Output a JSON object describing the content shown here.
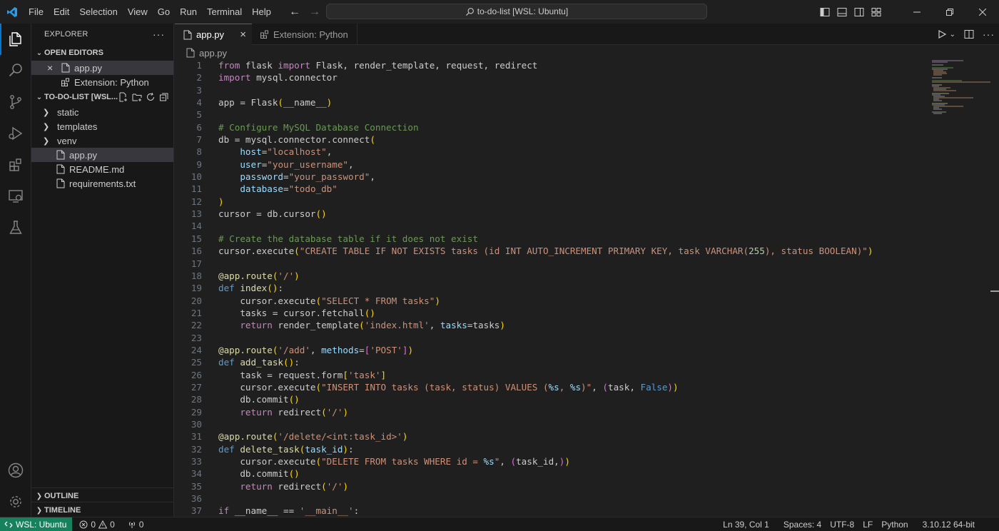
{
  "menu": [
    "File",
    "Edit",
    "Selection",
    "View",
    "Go",
    "Run",
    "Terminal",
    "Help"
  ],
  "command_center": {
    "text": "to-do-list [WSL: Ubuntu]"
  },
  "sidebar": {
    "title": "EXPLORER",
    "open_editors": {
      "label": "OPEN EDITORS",
      "items": [
        {
          "label": "app.py",
          "icon": "python-file-icon"
        },
        {
          "label": "Extension: Python",
          "icon": "extension-icon"
        }
      ]
    },
    "folder": {
      "label": "TO-DO-LIST [WSL...",
      "items": [
        {
          "label": "static",
          "type": "folder"
        },
        {
          "label": "templates",
          "type": "folder"
        },
        {
          "label": "venv",
          "type": "folder"
        },
        {
          "label": "app.py",
          "type": "file"
        },
        {
          "label": "README.md",
          "type": "file"
        },
        {
          "label": "requirements.txt",
          "type": "file"
        }
      ]
    },
    "outline_label": "OUTLINE",
    "timeline_label": "TIMELINE"
  },
  "tabs": [
    {
      "label": "app.py",
      "active": true
    },
    {
      "label": "Extension: Python",
      "active": false
    }
  ],
  "breadcrumb": {
    "file": "app.py"
  },
  "editor": {
    "line_numbers": [
      "1",
      "2",
      "3",
      "4",
      "5",
      "6",
      "7",
      "8",
      "9",
      "10",
      "11",
      "12",
      "13",
      "14",
      "15",
      "16",
      "17",
      "18",
      "19",
      "20",
      "21",
      "22",
      "23",
      "24",
      "25",
      "26",
      "27",
      "28",
      "29",
      "30",
      "31",
      "32",
      "33",
      "34",
      "35",
      "36",
      "37"
    ]
  },
  "status": {
    "remote": "WSL: Ubuntu",
    "errors": "0",
    "warnings": "0",
    "ports": "0",
    "position": "Ln 39, Col 1",
    "spaces": "Spaces: 4",
    "encoding": "UTF-8",
    "eol": "LF",
    "language": "Python",
    "interpreter": "3.10.12 64-bit"
  },
  "colors": {
    "accent": "#0078d4",
    "remote_bg": "#16825d",
    "keyword": "#c586c0",
    "string": "#ce9178",
    "comment": "#6a9955",
    "function": "#dcdcaa"
  }
}
